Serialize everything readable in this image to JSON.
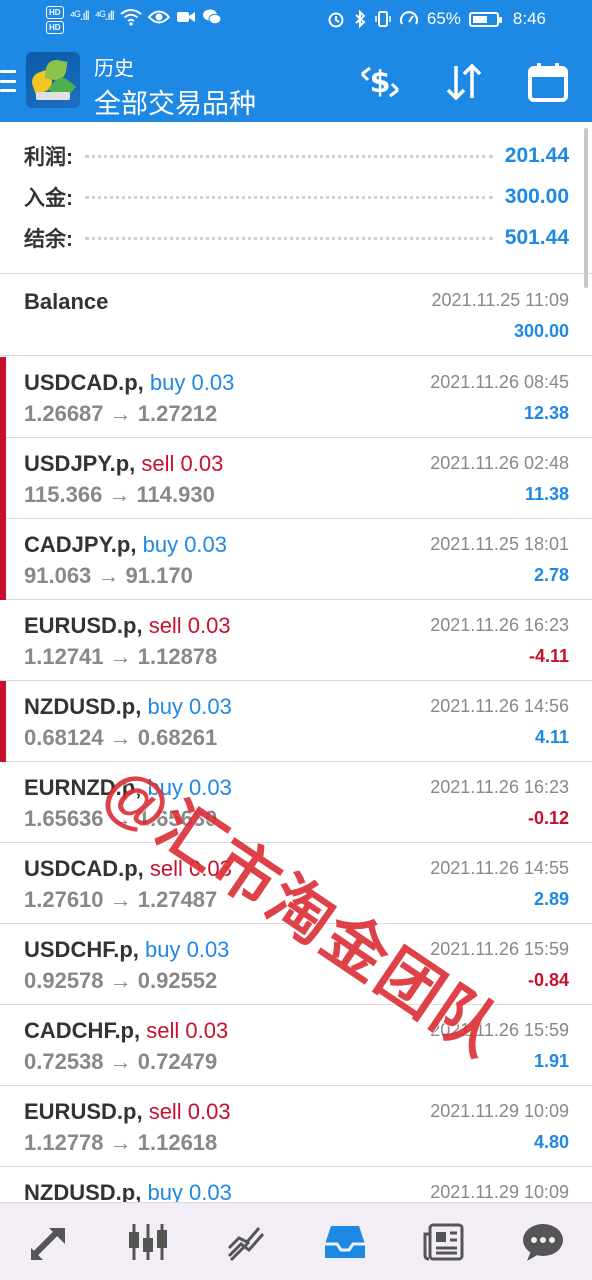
{
  "status_bar": {
    "hd1": "HD",
    "hd2": "HD",
    "sig1": "⁴ᴳ.ıll",
    "sig2": "⁴ᴳ.ıll",
    "battery_percent": "65%",
    "battery_level": 0.65,
    "time": "8:46"
  },
  "header": {
    "subtitle": "历史",
    "title": "全部交易品种",
    "colors": {
      "bar": "#1e88e5"
    }
  },
  "summary": [
    {
      "label": "利润:",
      "value": "201.44"
    },
    {
      "label": "入金:",
      "value": "300.00"
    },
    {
      "label": "结余:",
      "value": "501.44"
    }
  ],
  "balance_entry": {
    "title": "Balance",
    "time": "2021.11.25 11:09",
    "amount": "300.00"
  },
  "deals": [
    {
      "symbol": "USDCAD.p,",
      "direction": "buy 0.03",
      "prices": "1.26687 → 1.27212",
      "time": "2021.11.26 08:45",
      "profit": "12.38"
    },
    {
      "symbol": "USDJPY.p,",
      "direction": "sell 0.03",
      "prices": "115.366 → 114.930",
      "time": "2021.11.26 02:48",
      "profit": "11.38"
    },
    {
      "symbol": "CADJPY.p,",
      "direction": "buy 0.03",
      "prices": "91.063 → 91.170",
      "time": "2021.11.25 18:01",
      "profit": "2.78"
    },
    {
      "symbol": "EURUSD.p,",
      "direction": "sell 0.03",
      "prices": "1.12741 → 1.12878",
      "time": "2021.11.26 16:23",
      "profit": "-4.11"
    },
    {
      "symbol": "NZDUSD.p,",
      "direction": "buy 0.03",
      "prices": "0.68124 → 0.68261",
      "time": "2021.11.26 14:56",
      "profit": "4.11"
    },
    {
      "symbol": "EURNZD.p,",
      "direction": "buy 0.03",
      "prices": "1.65636 → 1.65630",
      "time": "2021.11.26 16:23",
      "profit": "-0.12"
    },
    {
      "symbol": "USDCAD.p,",
      "direction": "sell 0.03",
      "prices": "1.27610 → 1.27487",
      "time": "2021.11.26 14:55",
      "profit": "2.89"
    },
    {
      "symbol": "USDCHF.p,",
      "direction": "buy 0.03",
      "prices": "0.92578 → 0.92552",
      "time": "2021.11.26 15:59",
      "profit": "-0.84"
    },
    {
      "symbol": "CADCHF.p,",
      "direction": "sell 0.03",
      "prices": "0.72538 → 0.72479",
      "time": "2021.11.26 15:59",
      "profit": "1.91"
    },
    {
      "symbol": "EURUSD.p,",
      "direction": "sell 0.03",
      "prices": "1.12778 → 1.12618",
      "time": "2021.11.29 10:09",
      "profit": "4.80"
    },
    {
      "symbol": "NZDUSD.p,",
      "direction": "buy 0.03",
      "prices": "",
      "time": "2021.11.29 10:09",
      "profit": ""
    }
  ],
  "watermark": "@汇市淘金团队",
  "bottom_nav": [
    {
      "icon": "trade-icon"
    },
    {
      "icon": "candlestick-chart-icon"
    },
    {
      "icon": "line-chart-icon"
    },
    {
      "icon": "history-inbox-icon",
      "active": true
    },
    {
      "icon": "news-icon"
    },
    {
      "icon": "chat-icon"
    }
  ],
  "colors": {
    "positive": "#1e88e5",
    "negative": "#c8102e",
    "active_nav": "#1e88e5",
    "nav_icon": "#555555"
  }
}
